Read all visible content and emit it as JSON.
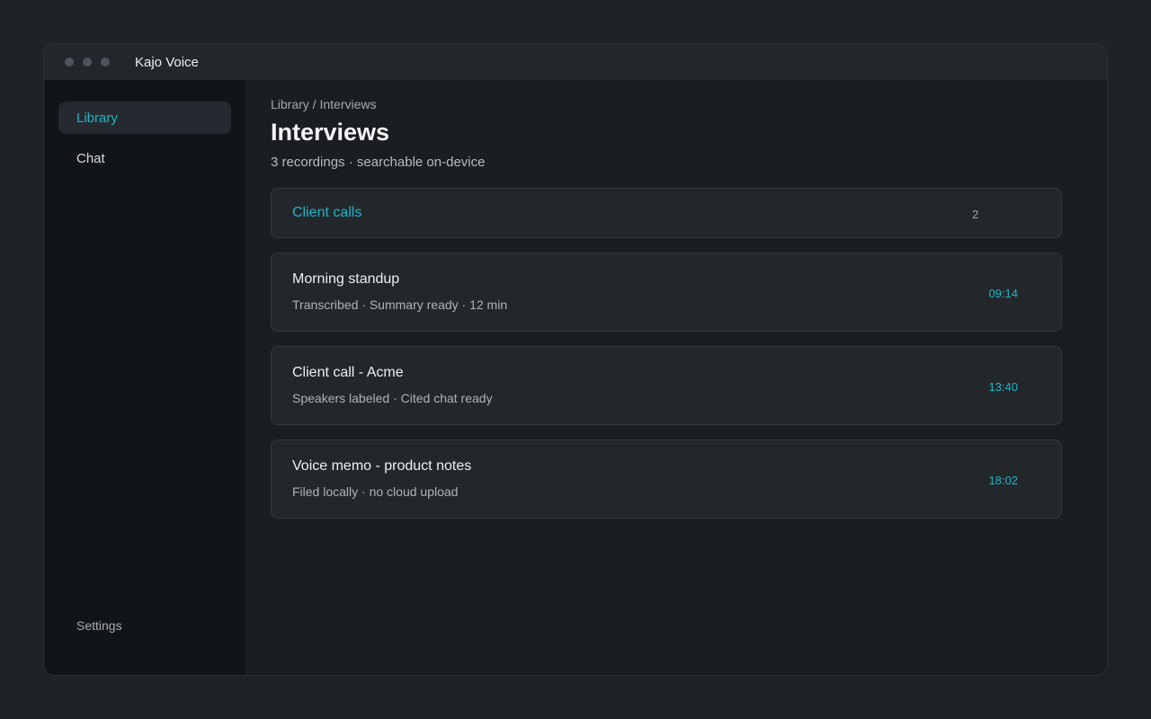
{
  "window": {
    "title": "Kajo Voice"
  },
  "sidebar": {
    "items": [
      {
        "label": "Library",
        "active": true
      },
      {
        "label": "Chat",
        "active": false
      }
    ],
    "settings_label": "Settings"
  },
  "main": {
    "breadcrumb": "Library / Interviews",
    "title": "Interviews",
    "subtitle": "3 recordings · searchable on-device",
    "folder": {
      "name": "Client calls",
      "count": "2"
    },
    "recordings": [
      {
        "title": "Morning standup",
        "meta": "Transcribed · Summary ready · 12 min",
        "time": "09:14"
      },
      {
        "title": "Client call - Acme",
        "meta": "Speakers labeled · Cited chat ready",
        "time": "13:40"
      },
      {
        "title": "Voice memo - product notes",
        "meta": "Filed locally · no cloud upload",
        "time": "18:02"
      }
    ]
  },
  "colors": {
    "accent": "#22b5c4",
    "background": "#1f2227",
    "sidebar": "#111418",
    "card": "#23272c"
  }
}
